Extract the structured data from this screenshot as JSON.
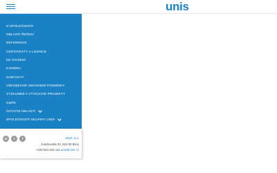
{
  "header": {
    "logo_text": "unis"
  },
  "sidebar": {
    "items": [
      {
        "label": "O společnosti",
        "has_submenu": false
      },
      {
        "label": "Oblasti řešení",
        "has_submenu": false
      },
      {
        "label": "Reference",
        "has_submenu": false
      },
      {
        "label": "Certifikáty a licence",
        "has_submenu": false
      },
      {
        "label": "Ke stažení",
        "has_submenu": false
      },
      {
        "label": "Kariéra",
        "has_submenu": false
      },
      {
        "label": "Kontakty",
        "has_submenu": false
      },
      {
        "label": "Všeobecné obchodní podmínky",
        "has_submenu": false
      },
      {
        "label": "Výzkumné a vývojové projekty",
        "has_submenu": false
      },
      {
        "label": "GDPR",
        "has_submenu": false
      },
      {
        "label": "Ostatní oblasti",
        "has_submenu": true
      },
      {
        "label": "Společnosti skupiny UNIS",
        "has_submenu": true
      }
    ]
  },
  "footer": {
    "socials": [
      "in",
      "t",
      "f"
    ],
    "company": "UNIS, a.s.",
    "address": "Jundrovská 33, 624 00 Brno",
    "phone": "+420 541 515 111",
    "email": "unis@unis.cz"
  },
  "colors": {
    "brand_blue": "#1a82c4",
    "icon_gray": "#9a9a9a"
  }
}
